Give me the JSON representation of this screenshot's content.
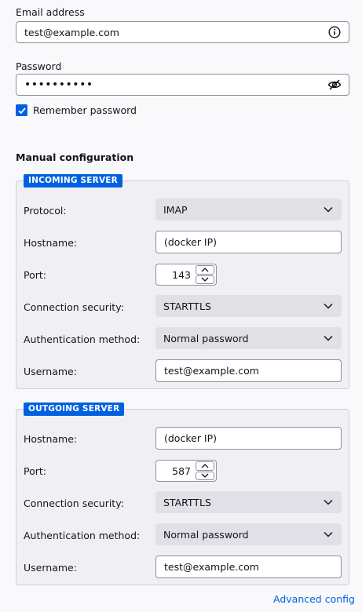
{
  "account": {
    "email_label": "Email address",
    "email_value": "test@example.com",
    "password_label": "Password",
    "password_value": "••••••••••",
    "remember_label": "Remember password",
    "remember_checked": true
  },
  "manual": {
    "title": "Manual configuration",
    "incoming": {
      "legend": "INCOMING SERVER",
      "protocol_label": "Protocol:",
      "protocol_value": "IMAP",
      "hostname_label": "Hostname:",
      "hostname_value": "(docker IP)",
      "port_label": "Port:",
      "port_value": "143",
      "security_label": "Connection security:",
      "security_value": "STARTTLS",
      "auth_label": "Authentication method:",
      "auth_value": "Normal password",
      "username_label": "Username:",
      "username_value": "test@example.com"
    },
    "outgoing": {
      "legend": "OUTGOING SERVER",
      "hostname_label": "Hostname:",
      "hostname_value": "(docker IP)",
      "port_label": "Port:",
      "port_value": "587",
      "security_label": "Connection security:",
      "security_value": "STARTTLS",
      "auth_label": "Authentication method:",
      "auth_value": "Normal password",
      "username_label": "Username:",
      "username_value": "test@example.com"
    }
  },
  "footer": {
    "advanced_link": "Advanced config"
  },
  "colors": {
    "accent": "#0061e0",
    "background": "#f9f9fb",
    "fieldset_bg": "#f0f0f4",
    "select_bg": "#e0e0e6"
  },
  "icons": {
    "email_trailing": "info-circle-icon",
    "password_trailing": "eye-slash-icon",
    "select_arrow": "chevron-down-icon",
    "stepper_up": "chevron-up-icon",
    "stepper_down": "chevron-down-icon",
    "checkbox": "checkmark-icon"
  }
}
